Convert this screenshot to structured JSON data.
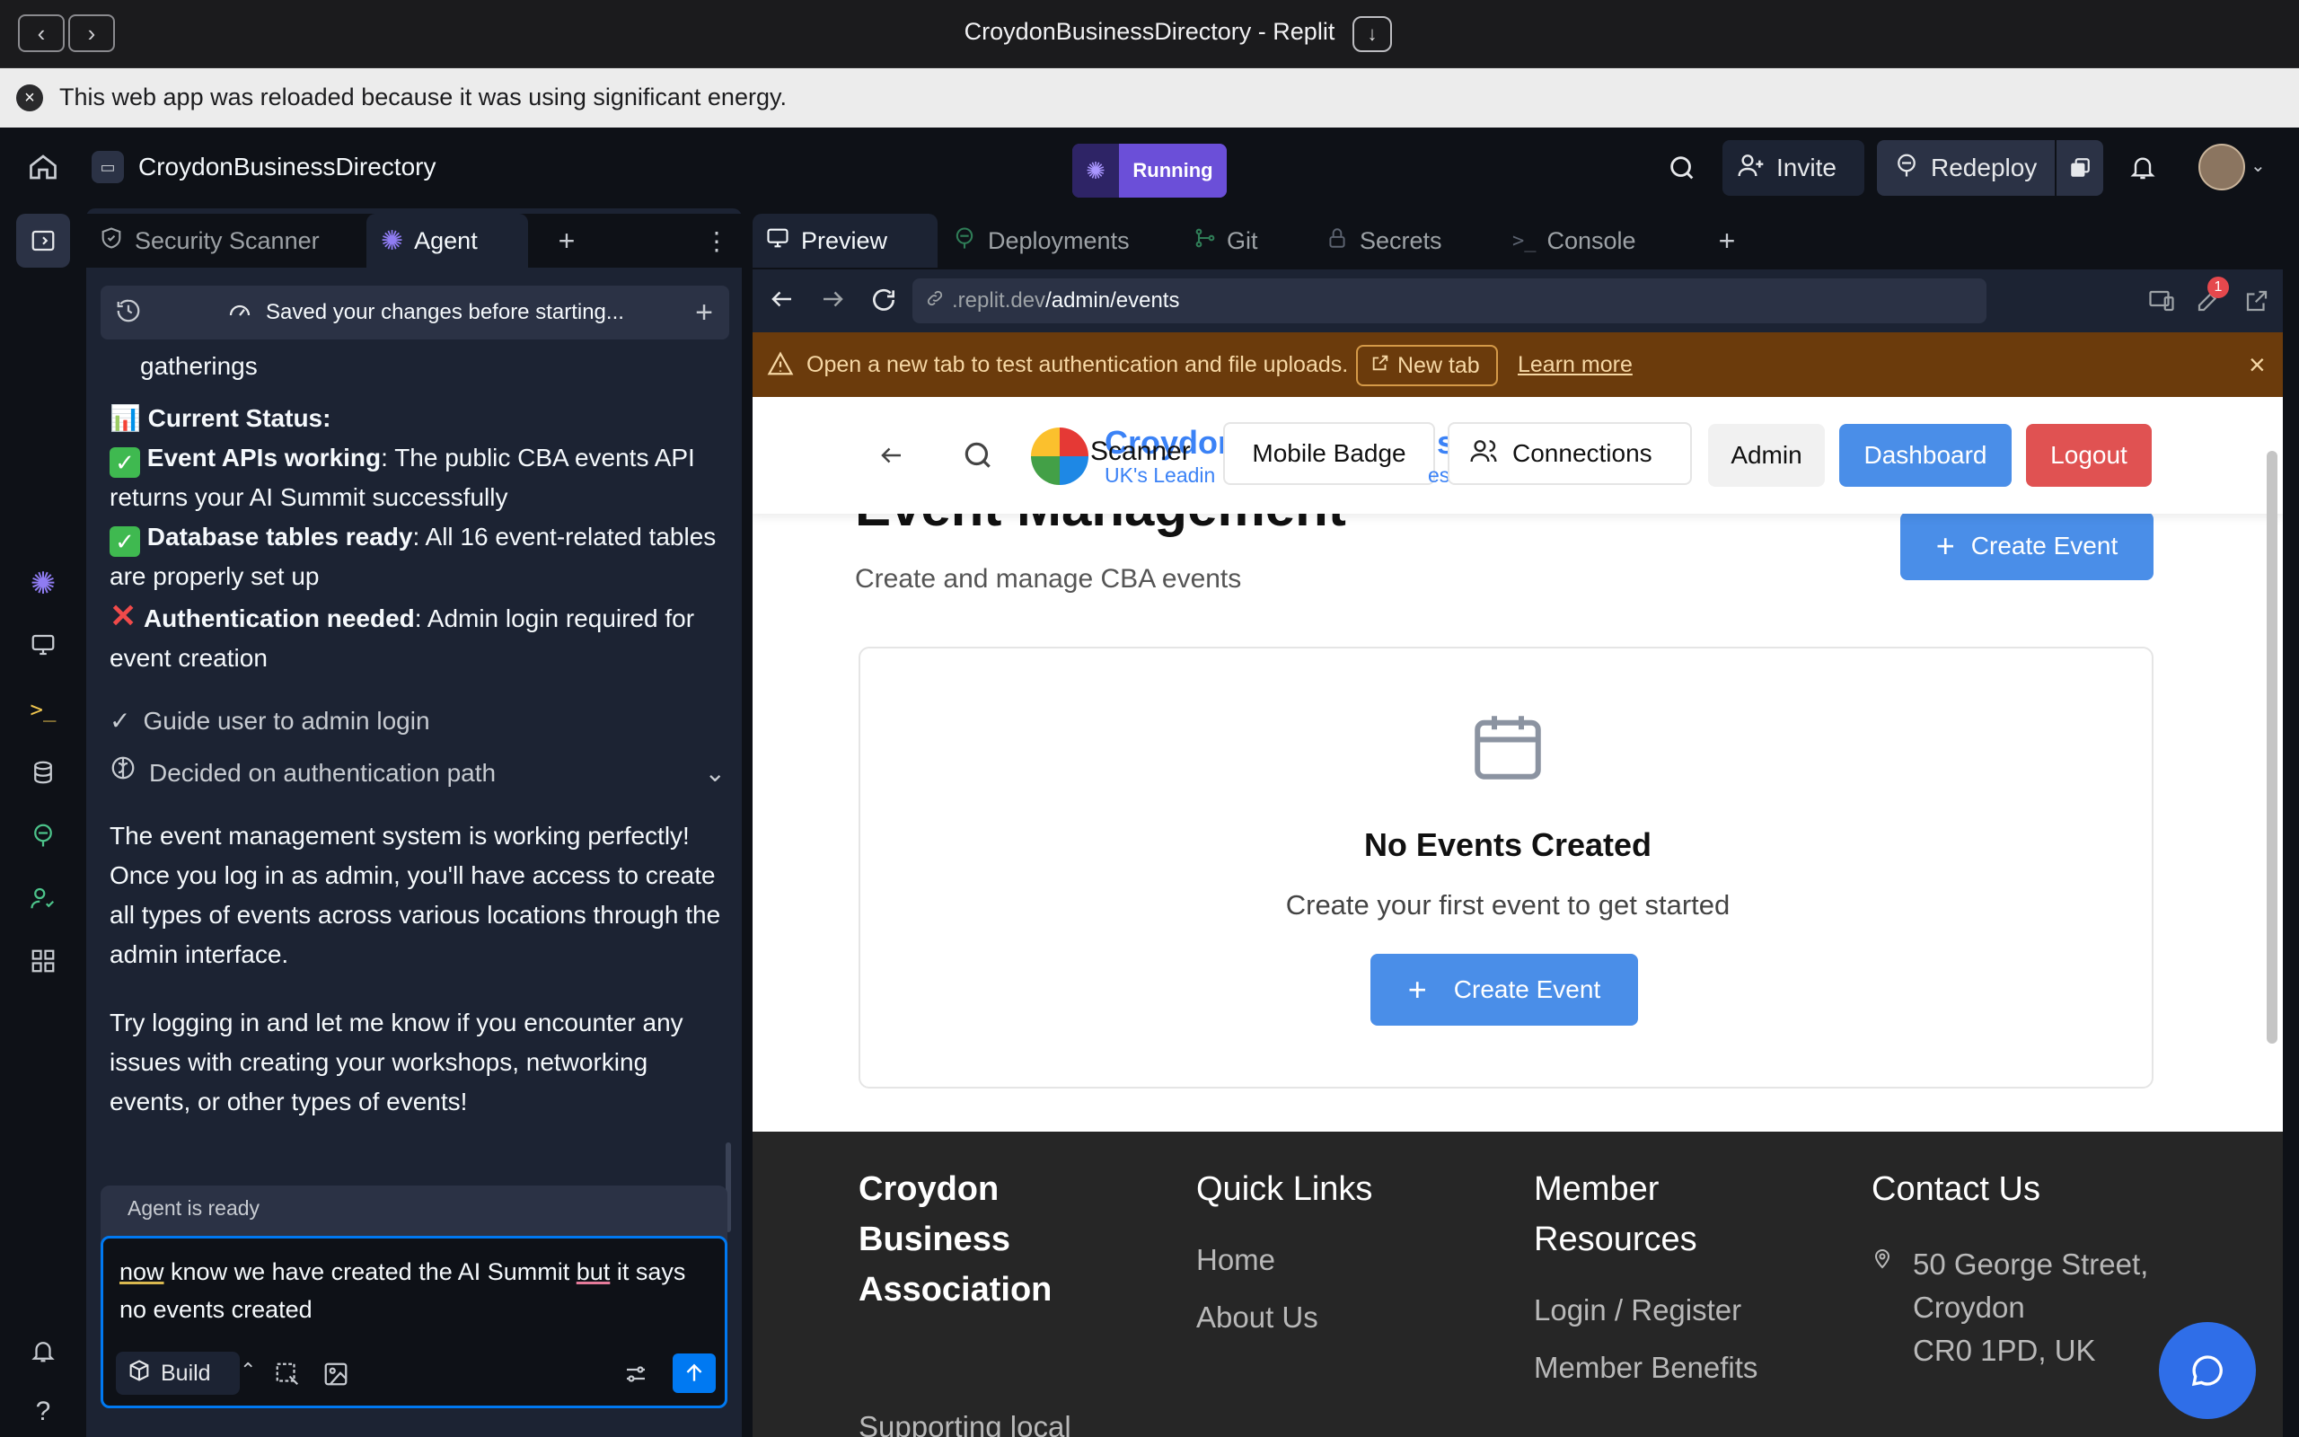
{
  "window": {
    "title": "CroydonBusinessDirectory - Replit"
  },
  "notice": {
    "text": "This web app was reloaded because it was using significant energy."
  },
  "appbar": {
    "project_name": "CroydonBusinessDirectory",
    "status": "Running",
    "invite": "Invite",
    "redeploy": "Redeploy"
  },
  "left_tabs": {
    "security": "Security Scanner",
    "agent": "Agent"
  },
  "history": {
    "label": "Saved your changes before starting..."
  },
  "chat": {
    "cont_text": "gatherings",
    "status_heading": "Current Status:",
    "line1_bold": "Event APIs working",
    "line1_rest": ": The public CBA events API returns your AI Summit successfully",
    "line2_bold": "Database tables ready",
    "line2_rest": ": All 16 event-related tables are properly set up",
    "line3_bold": "Authentication needed",
    "line3_rest": ": Admin login required for event creation",
    "step1": "Guide user to admin login",
    "step2": "Decided on authentication path",
    "para1": "The event management system is working perfectly! Once you log in as admin, you'll have access to create all types of events across various locations through the admin interface.",
    "para2": "Try logging in and let me know if you encounter any issues with creating your workshops, networking events, or other types of events!"
  },
  "composer": {
    "status": "Agent is ready",
    "text_w1": "now",
    "text_mid": " know we have created the AI Summit ",
    "text_w2": "but",
    "text_end": " it says no events created",
    "mode": "Build"
  },
  "right_tabs": {
    "preview": "Preview",
    "deployments": "Deployments",
    "git": "Git",
    "secrets": "Secrets",
    "console": "Console"
  },
  "url": {
    "prefix": ".replit.dev",
    "path": "/admin/events"
  },
  "devtools_badge": "1",
  "warning": {
    "text": "Open a new tab to test authentication and file uploads.",
    "new_tab": "New tab",
    "learn": "Learn more"
  },
  "site": {
    "brand": "Croydon",
    "brand_end": "s",
    "tagline": "UK's Leadin",
    "tagline_end": "es",
    "scanner": "Scanner",
    "nav": {
      "mobile_badge": "Mobile Badge",
      "connections": "Connections",
      "admin": "Admin",
      "dashboard": "Dashboard",
      "logout": "Logout"
    },
    "page_title": "Event Management",
    "page_sub": "Create and manage CBA events",
    "create_event": "Create Event",
    "empty_title": "No Events Created",
    "empty_sub": "Create your first event to get started",
    "empty_btn": "Create Event",
    "footer": {
      "col1_title": "Croydon Business Association",
      "col1_text": "Supporting local",
      "col2_title": "Quick Links",
      "col2_links": [
        "Home",
        "About Us"
      ],
      "col3_title": "Member Resources",
      "col3_links": [
        "Login / Register",
        "Member Benefits"
      ],
      "col4_title": "Contact Us",
      "col4_address": [
        "50 George Street,",
        "Croydon",
        "CR0 1PD, UK"
      ]
    }
  },
  "colors": {
    "accent": "#4a8ee8",
    "logout": "#e05252",
    "running": "#6b4fd8",
    "warning_bg": "#6b3b0c"
  }
}
